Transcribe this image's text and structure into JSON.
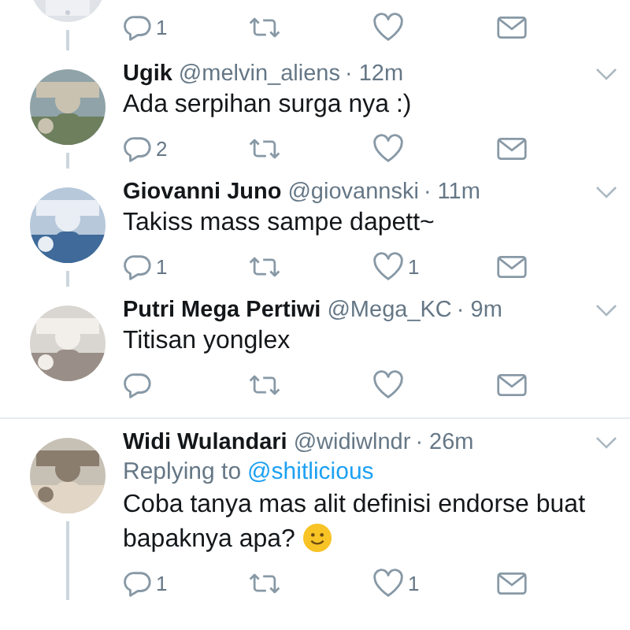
{
  "tweets": [
    {
      "kind": "partial",
      "thread_below": true,
      "reply_count": "1"
    },
    {
      "kind": "tweet",
      "name": "Ugik",
      "handle": "@melvin_aliens",
      "time": "· 12m",
      "text": "Ada serpihan surga nya :)",
      "thread_below": true,
      "reply_count": "2"
    },
    {
      "kind": "tweet",
      "name": "Giovanni Juno",
      "handle": "@giovannski",
      "time": "· 11m",
      "text": "Takiss mass sampe dapett~",
      "thread_below": true,
      "reply_count": "1",
      "like_count": "1"
    },
    {
      "kind": "tweet",
      "name": "Putri Mega Pertiwi",
      "handle": "@Mega_KC",
      "time": "· 9m",
      "text": "Titisan yonglex",
      "thread_below": false
    },
    {
      "kind": "tweet",
      "name": "Widi Wulandari",
      "handle": "@widiwlndr",
      "time": "· 26m",
      "replying_label": "Replying to",
      "replying_to": "@shitlicious",
      "text": "Coba tanya mas alit definisi endorse buat bapaknya apa?",
      "smiley": true,
      "thread_below": true,
      "reply_count": "1",
      "like_count": "1"
    }
  ]
}
